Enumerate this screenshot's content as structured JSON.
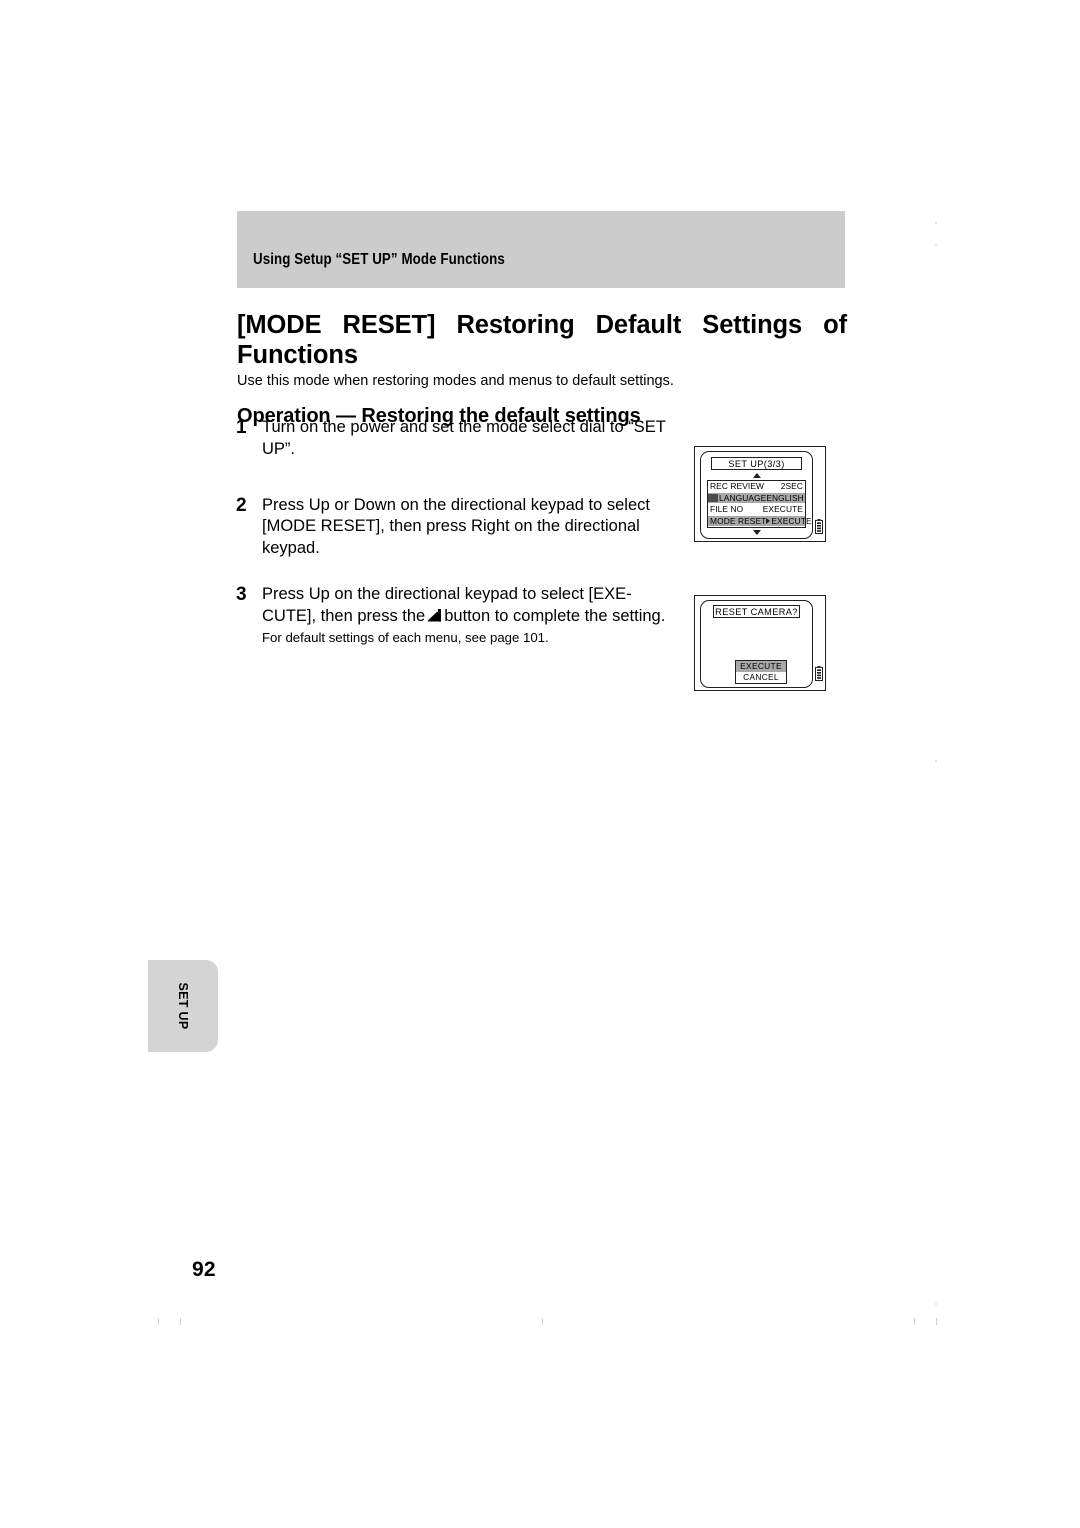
{
  "document": {
    "running_header": "Using Setup “SET UP” Mode Functions",
    "title_line1": "[MODE RESET]  Restoring  Default  Settings  of",
    "title_line2": "Functions",
    "lede": "Use this mode when restoring modes and menus to default settings.",
    "operation_heading": "Operation — Restoring the default settings",
    "page_number": "92",
    "side_tab_label": "SET UP"
  },
  "steps": [
    {
      "number": "1",
      "text": "Turn on the power and set the mode select dial to “SET UP”."
    },
    {
      "number": "2",
      "text": "Press Up or Down on the directional keypad to select [MODE RESET], then press Right on the directional keypad."
    },
    {
      "number": "3",
      "text_before_glyph": "Press Up on the directional keypad to select [EXE-CUTE], then press the",
      "glyph": "enter-button-icon",
      "text_after_glyph": "button to complete the setting.",
      "note": "For default settings of each menu, see page 101."
    }
  ],
  "lcd_screens": [
    {
      "name": "setup-menu-screen",
      "title": "SET  UP(3/3)",
      "scroll_up": "▲",
      "scroll_down": "▼",
      "battery_icon": "battery-icon",
      "rows": [
        {
          "label": "REC REVIEW",
          "value": "2SEC",
          "highlighted": false,
          "has_icon": false,
          "caret": false
        },
        {
          "label": "LANGUAGE",
          "value": "ENGLISH",
          "highlighted": true,
          "has_icon": true,
          "caret": false
        },
        {
          "label": "FILE NO",
          "value": "EXECUTE",
          "highlighted": false,
          "has_icon": false,
          "caret": false
        },
        {
          "label": "MODE RESET",
          "value": "EXECUTE",
          "highlighted": true,
          "has_icon": false,
          "caret": true
        }
      ]
    },
    {
      "name": "reset-confirm-screen",
      "title": "RESET  CAMERA?",
      "battery_icon": "battery-icon",
      "choices": [
        {
          "label": "EXECUTE",
          "highlighted": true
        },
        {
          "label": "CANCEL",
          "highlighted": false
        }
      ]
    }
  ],
  "colors": {
    "header_band": "#cccccc",
    "side_tab": "#d4d4d4",
    "lcd_highlight": "#a8a8a8",
    "ink": "#000000"
  }
}
